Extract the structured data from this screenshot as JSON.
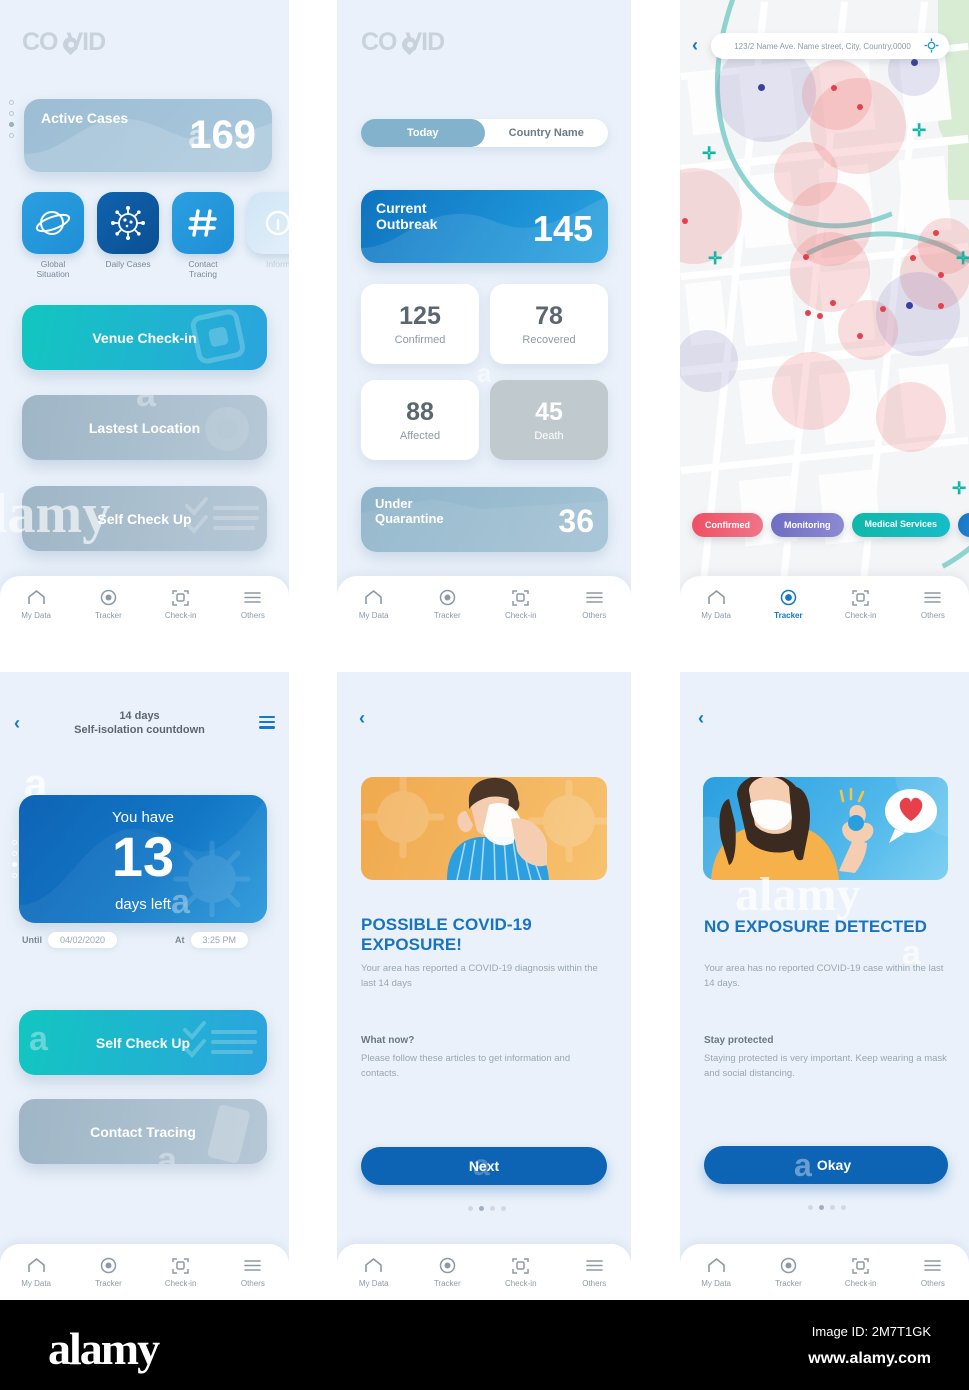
{
  "brand": {
    "co": "CO",
    "vid": "VID"
  },
  "screen1": {
    "hero": {
      "label": "Active Cases",
      "value": "169"
    },
    "quick_actions": [
      {
        "label": "Global\nSituation",
        "label_l1": "Global",
        "label_l2": "Situation",
        "icon": "planet-icon"
      },
      {
        "label": "Daily Cases",
        "label_l1": "Daily Cases",
        "label_l2": "",
        "icon": "virus-icon"
      },
      {
        "label": "Contact\nTracing",
        "label_l1": "Contact",
        "label_l2": "Tracing",
        "icon": "hash-icon"
      },
      {
        "label": "Information",
        "label_l1": "Inform",
        "label_l2": "",
        "icon": "info-icon"
      }
    ],
    "buttons": [
      {
        "label": "Venue Check-in",
        "style": "teal"
      },
      {
        "label": "Lastest Location",
        "style": "muted"
      },
      {
        "label": "Self Check Up",
        "style": "muted"
      }
    ]
  },
  "screen2": {
    "toggle": {
      "selected": "Today",
      "other": "Country Name"
    },
    "hero": {
      "label_l1": "Current",
      "label_l2": "Outbreak",
      "value": "145"
    },
    "stats": [
      {
        "value": "125",
        "label": "Confirmed",
        "muted": false
      },
      {
        "value": "78",
        "label": "Recovered",
        "muted": false
      },
      {
        "value": "88",
        "label": "Affected",
        "muted": false
      },
      {
        "value": "45",
        "label": "Death",
        "muted": true
      }
    ],
    "quarantine": {
      "label_l1": "Under",
      "label_l2": "Quarantine",
      "value": "36"
    }
  },
  "screen3": {
    "search_value": "123/2 Name Ave. Name street, City, Country,0000",
    "back_icon": "chevron-left-icon",
    "locate_icon": "crosshair-icon",
    "legend": [
      {
        "label": "Confirmed",
        "color": "#ef4f63"
      },
      {
        "label": "Monitoring",
        "color": "#7b79c6"
      },
      {
        "label": "Medical Services",
        "color": "#13b7b0"
      },
      {
        "label": "",
        "color": "#1673c4"
      }
    ]
  },
  "screen4": {
    "header_l1": "14 days",
    "header_l2": "Self-isolation countdown",
    "hero": {
      "top": "You have",
      "value": "13",
      "bottom": "days left"
    },
    "until": {
      "label": "Until",
      "value": "04/02/2020"
    },
    "at": {
      "label": "At",
      "value": "3:25 PM"
    },
    "buttons": [
      {
        "label": "Self Check Up",
        "style": "teal"
      },
      {
        "label": "Contact Tracing",
        "style": "muted"
      }
    ]
  },
  "screen5": {
    "title_l1": "POSSIBLE COVID-19",
    "title_l2": "EXPOSURE!",
    "body": "Your area has reported a COVID-19 diagnosis within the last 14 days",
    "sub_title": "What now?",
    "sub_body": "Please follow these articles to get information and contacts.",
    "cta": "Next",
    "illustration": "man-sneezing-into-tissue"
  },
  "screen6": {
    "title_l1": "NO EXPOSURE DETECTED",
    "body": "Your area has no reported COVID-19 case within the last 14 days.",
    "sub_title": "Stay protected",
    "sub_body": "Staying protected is very important. Keep wearing a mask and social distancing.",
    "cta": "Okay",
    "illustration": "woman-with-mask-ok-gesture"
  },
  "bottom_nav": [
    {
      "label": "My Data",
      "icon": "home-icon"
    },
    {
      "label": "Tracker",
      "icon": "target-icon"
    },
    {
      "label": "Check-in",
      "icon": "scan-icon"
    },
    {
      "label": "Others",
      "icon": "menu-icon"
    }
  ],
  "footer": {
    "logo": "alamy",
    "image_id": "Image ID: 2M7T1GK",
    "url": "www.alamy.com"
  },
  "colors": {
    "bg": "#eaf1fa",
    "accent_blue": "#1279c6",
    "teal": "#11c1c6",
    "muted": "#9fb8ca"
  }
}
